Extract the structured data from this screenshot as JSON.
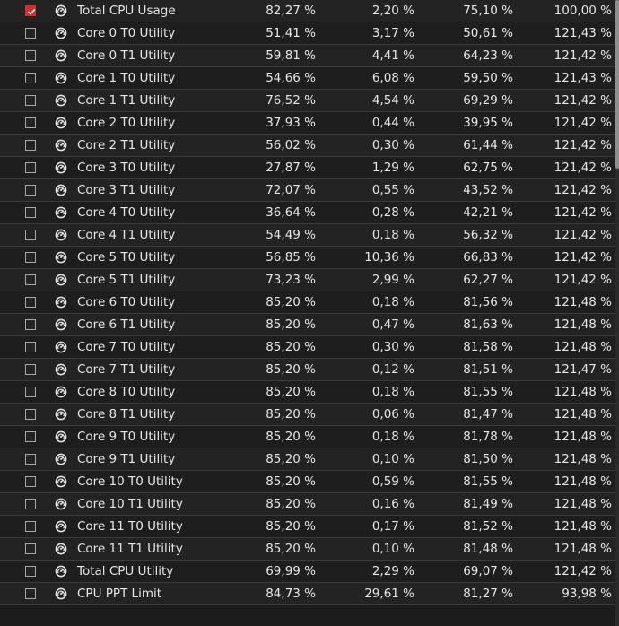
{
  "rows": [
    {
      "checked": true,
      "name": "Total CPU Usage",
      "v1": "82,27 %",
      "v2": "2,20 %",
      "v3": "75,10 %",
      "v4": "100,00 %"
    },
    {
      "checked": false,
      "name": "Core 0 T0 Utility",
      "v1": "51,41 %",
      "v2": "3,17 %",
      "v3": "50,61 %",
      "v4": "121,43 %"
    },
    {
      "checked": false,
      "name": "Core 0 T1 Utility",
      "v1": "59,81 %",
      "v2": "4,41 %",
      "v3": "64,23 %",
      "v4": "121,42 %"
    },
    {
      "checked": false,
      "name": "Core 1 T0 Utility",
      "v1": "54,66 %",
      "v2": "6,08 %",
      "v3": "59,50 %",
      "v4": "121,43 %"
    },
    {
      "checked": false,
      "name": "Core 1 T1 Utility",
      "v1": "76,52 %",
      "v2": "4,54 %",
      "v3": "69,29 %",
      "v4": "121,42 %"
    },
    {
      "checked": false,
      "name": "Core 2 T0 Utility",
      "v1": "37,93 %",
      "v2": "0,44 %",
      "v3": "39,95 %",
      "v4": "121,42 %"
    },
    {
      "checked": false,
      "name": "Core 2 T1 Utility",
      "v1": "56,02 %",
      "v2": "0,30 %",
      "v3": "61,44 %",
      "v4": "121,42 %"
    },
    {
      "checked": false,
      "name": "Core 3 T0 Utility",
      "v1": "27,87 %",
      "v2": "1,29 %",
      "v3": "62,75 %",
      "v4": "121,42 %"
    },
    {
      "checked": false,
      "name": "Core 3 T1 Utility",
      "v1": "72,07 %",
      "v2": "0,55 %",
      "v3": "43,52 %",
      "v4": "121,42 %"
    },
    {
      "checked": false,
      "name": "Core 4 T0 Utility",
      "v1": "36,64 %",
      "v2": "0,28 %",
      "v3": "42,21 %",
      "v4": "121,42 %"
    },
    {
      "checked": false,
      "name": "Core 4 T1 Utility",
      "v1": "54,49 %",
      "v2": "0,18 %",
      "v3": "56,32 %",
      "v4": "121,42 %"
    },
    {
      "checked": false,
      "name": "Core 5 T0 Utility",
      "v1": "56,85 %",
      "v2": "10,36 %",
      "v3": "66,83 %",
      "v4": "121,42 %"
    },
    {
      "checked": false,
      "name": "Core 5 T1 Utility",
      "v1": "73,23 %",
      "v2": "2,99 %",
      "v3": "62,27 %",
      "v4": "121,42 %"
    },
    {
      "checked": false,
      "name": "Core 6 T0 Utility",
      "v1": "85,20 %",
      "v2": "0,18 %",
      "v3": "81,56 %",
      "v4": "121,48 %"
    },
    {
      "checked": false,
      "name": "Core 6 T1 Utility",
      "v1": "85,20 %",
      "v2": "0,47 %",
      "v3": "81,63 %",
      "v4": "121,48 %"
    },
    {
      "checked": false,
      "name": "Core 7 T0 Utility",
      "v1": "85,20 %",
      "v2": "0,30 %",
      "v3": "81,58 %",
      "v4": "121,48 %"
    },
    {
      "checked": false,
      "name": "Core 7 T1 Utility",
      "v1": "85,20 %",
      "v2": "0,12 %",
      "v3": "81,51 %",
      "v4": "121,47 %"
    },
    {
      "checked": false,
      "name": "Core 8 T0 Utility",
      "v1": "85,20 %",
      "v2": "0,18 %",
      "v3": "81,55 %",
      "v4": "121,48 %"
    },
    {
      "checked": false,
      "name": "Core 8 T1 Utility",
      "v1": "85,20 %",
      "v2": "0,06 %",
      "v3": "81,47 %",
      "v4": "121,48 %"
    },
    {
      "checked": false,
      "name": "Core 9 T0 Utility",
      "v1": "85,20 %",
      "v2": "0,18 %",
      "v3": "81,78 %",
      "v4": "121,48 %"
    },
    {
      "checked": false,
      "name": "Core 9 T1 Utility",
      "v1": "85,20 %",
      "v2": "0,10 %",
      "v3": "81,50 %",
      "v4": "121,48 %"
    },
    {
      "checked": false,
      "name": "Core 10 T0 Utility",
      "v1": "85,20 %",
      "v2": "0,59 %",
      "v3": "81,55 %",
      "v4": "121,48 %"
    },
    {
      "checked": false,
      "name": "Core 10 T1 Utility",
      "v1": "85,20 %",
      "v2": "0,16 %",
      "v3": "81,49 %",
      "v4": "121,48 %"
    },
    {
      "checked": false,
      "name": "Core 11 T0 Utility",
      "v1": "85,20 %",
      "v2": "0,17 %",
      "v3": "81,52 %",
      "v4": "121,48 %"
    },
    {
      "checked": false,
      "name": "Core 11 T1 Utility",
      "v1": "85,20 %",
      "v2": "0,10 %",
      "v3": "81,48 %",
      "v4": "121,48 %"
    },
    {
      "checked": false,
      "name": "Total CPU Utility",
      "v1": "69,99 %",
      "v2": "2,29 %",
      "v3": "69,07 %",
      "v4": "121,42 %"
    },
    {
      "checked": false,
      "name": "CPU PPT Limit",
      "v1": "84,73 %",
      "v2": "29,61 %",
      "v3": "81,27 %",
      "v4": "93,98 %"
    }
  ],
  "icons": {
    "row": "sensor-gauge-icon",
    "check": "checkmark-icon"
  },
  "colors": {
    "accent": "#d32f2f",
    "background": "#1c1c1c",
    "text": "#e6e6e6"
  },
  "scrollbar": {
    "visible_fraction": 0.27,
    "position_fraction": 0.0
  }
}
